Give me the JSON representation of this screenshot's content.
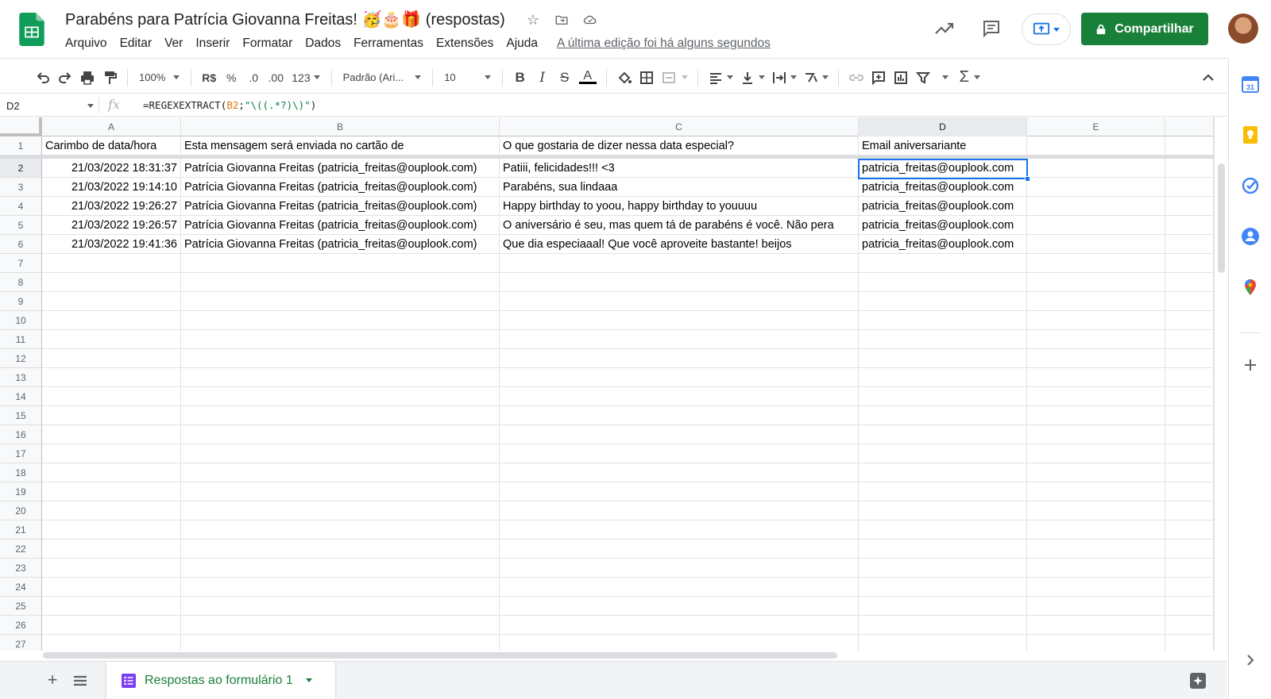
{
  "doc": {
    "title": "Parabéns para Patrícia Giovanna Freitas! 🥳🎂🎁 (respostas)"
  },
  "menu": [
    "Arquivo",
    "Editar",
    "Ver",
    "Inserir",
    "Formatar",
    "Dados",
    "Ferramentas",
    "Extensões",
    "Ajuda"
  ],
  "last_edit": "A última edição foi há alguns segundos",
  "share_label": "Compartilhar",
  "toolbar": {
    "zoom": "100%",
    "currency": "R$",
    "percent": "%",
    "dec_less": ".0",
    "dec_more": ".00",
    "format_more": "123",
    "font": "Padrão (Ari...",
    "font_size": "10"
  },
  "formula_bar": {
    "cell_ref": "D2",
    "fx": "fx",
    "formula_prefix": "=REGEXEXTRACT(",
    "formula_ref": "B2",
    "formula_sep": ";",
    "formula_string": "\"\\((.*?)\\)\"",
    "formula_suffix": ")"
  },
  "columns": [
    "A",
    "B",
    "C",
    "D",
    "E"
  ],
  "header_row": [
    "Carimbo de data/hora",
    "Esta mensagem será enviada no cartão de",
    "O que gostaria de dizer nessa data especial?",
    "Email aniversariante",
    ""
  ],
  "data_rows": [
    [
      "21/03/2022 18:31:37",
      "Patrícia Giovanna Freitas (patricia_freitas@ouplook.com)",
      "Patiii, felicidades!!! <3",
      "patricia_freitas@ouplook.com"
    ],
    [
      "21/03/2022 19:14:10",
      "Patrícia Giovanna Freitas (patricia_freitas@ouplook.com)",
      "Parabéns, sua lindaaa",
      "patricia_freitas@ouplook.com"
    ],
    [
      "21/03/2022 19:26:27",
      "Patrícia Giovanna Freitas (patricia_freitas@ouplook.com)",
      "Happy birthday to yoou, happy birthday to youuuu",
      "patricia_freitas@ouplook.com"
    ],
    [
      "21/03/2022 19:26:57",
      "Patrícia Giovanna Freitas (patricia_freitas@ouplook.com)",
      "O aniversário é seu, mas quem tá de parabéns é você. Não pera",
      "patricia_freitas@ouplook.com"
    ],
    [
      "21/03/2022 19:41:36",
      "Patrícia Giovanna Freitas (patricia_freitas@ouplook.com)",
      "Que dia especiaaal! Que você aproveite bastante! beijos",
      "patricia_freitas@ouplook.com"
    ]
  ],
  "row_numbers": [
    "1",
    "2",
    "3",
    "4",
    "5",
    "6",
    "7",
    "8",
    "9",
    "10",
    "11",
    "12",
    "13",
    "14",
    "15",
    "16",
    "17",
    "18",
    "19",
    "20",
    "21",
    "22",
    "23",
    "24",
    "25",
    "26",
    "27"
  ],
  "selected_cell": "D2",
  "sheet_tab": {
    "label": "Respostas ao formulário 1"
  },
  "colors": {
    "share_green": "#188038",
    "selection_blue": "#1a73e8",
    "sheets_green": "#0f9d58",
    "form_purple": "#7e3ff2"
  },
  "side_panel": [
    "calendar-icon",
    "keep-icon",
    "tasks-icon",
    "contacts-icon",
    "maps-icon",
    "add-icon"
  ]
}
